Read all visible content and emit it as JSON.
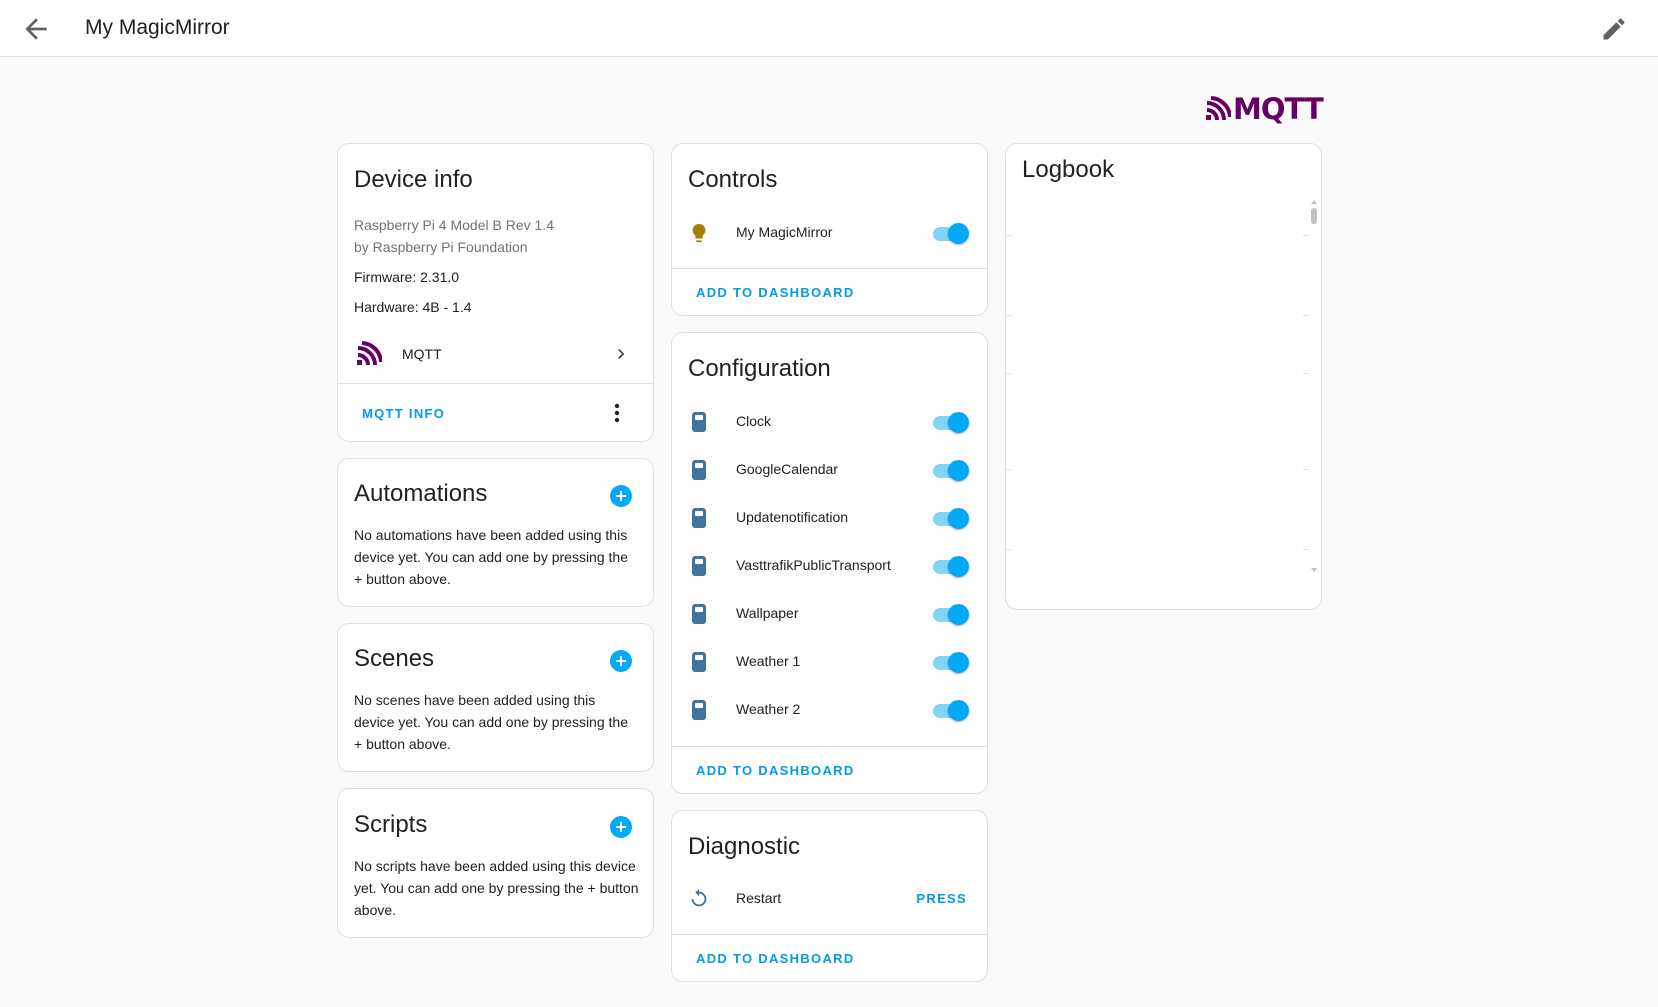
{
  "header": {
    "title": "My MagicMirror"
  },
  "brand": {
    "logo_text": "MQTT",
    "color": "#660066"
  },
  "device_info": {
    "title": "Device info",
    "model": "Raspberry Pi 4 Model B Rev 1.4",
    "manufacturer": "by Raspberry Pi Foundation",
    "firmware": "Firmware: 2.31.0",
    "hardware": "Hardware: 4B - 1.4",
    "integration_label": "MQTT",
    "action_label": "MQTT INFO"
  },
  "automations": {
    "title": "Automations",
    "description": "No automations have been added using this device yet. You can add one by pressing the + button above."
  },
  "scenes": {
    "title": "Scenes",
    "description": "No scenes have been added using this device yet. You can add one by pressing the + button above."
  },
  "scripts": {
    "title": "Scripts",
    "description": "No scripts have been added using this device yet. You can add one by pressing the + button above."
  },
  "controls": {
    "title": "Controls",
    "items": [
      {
        "label": "My MagicMirror",
        "icon": "lightbulb-icon",
        "on": true
      }
    ],
    "action_label": "ADD TO DASHBOARD"
  },
  "configuration": {
    "title": "Configuration",
    "items": [
      {
        "label": "Clock",
        "icon": "remote-icon",
        "on": true
      },
      {
        "label": "GoogleCalendar",
        "icon": "remote-icon",
        "on": true
      },
      {
        "label": "Updatenotification",
        "icon": "remote-icon",
        "on": true
      },
      {
        "label": "VasttrafikPublicTransport",
        "icon": "remote-icon",
        "on": true
      },
      {
        "label": "Wallpaper",
        "icon": "remote-icon",
        "on": true
      },
      {
        "label": "Weather 1",
        "icon": "remote-icon",
        "on": true
      },
      {
        "label": "Weather 2",
        "icon": "remote-icon",
        "on": true
      }
    ],
    "action_label": "ADD TO DASHBOARD"
  },
  "diagnostic": {
    "title": "Diagnostic",
    "items": [
      {
        "label": "Restart",
        "icon": "restart-icon",
        "button_label": "PRESS"
      }
    ],
    "action_label": "ADD TO DASHBOARD"
  },
  "logbook": {
    "title": "Logbook"
  },
  "colors": {
    "accent": "#03a9f4",
    "link": "#039be5",
    "toggle_track": "#81d4fa",
    "remote_icon": "#44739e",
    "lightbulb": "#a57d00"
  }
}
